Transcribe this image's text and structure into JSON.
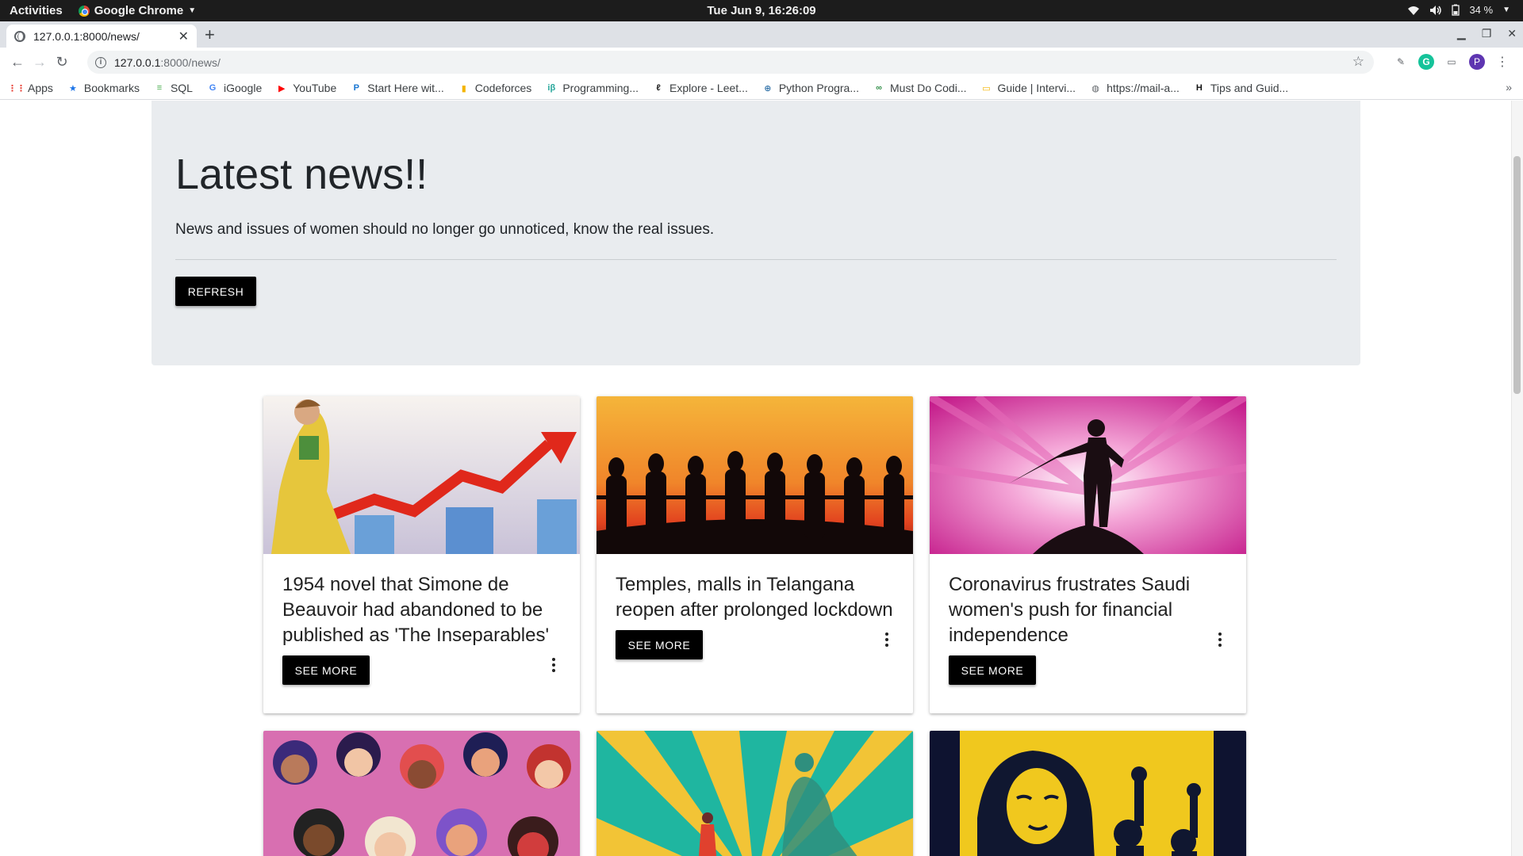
{
  "topbar": {
    "activities": "Activities",
    "app_name": "Google Chrome",
    "clock": "Tue Jun  9, 16:26:09",
    "battery": "34 %"
  },
  "browser": {
    "tab_title": "127.0.0.1:8000/news/",
    "url_host": "127.0.0.1",
    "url_path": ":8000/news/",
    "profile_initial": "P",
    "bookmarks": [
      {
        "label": "Apps",
        "icon": "apps-grid-icon",
        "color": "#e8453c"
      },
      {
        "label": "Bookmarks",
        "icon": "star-icon",
        "color": "#1a73e8"
      },
      {
        "label": "SQL",
        "icon": "sql-icon",
        "color": "#4caf50"
      },
      {
        "label": "iGoogle",
        "icon": "google-icon",
        "color": "#4285f4"
      },
      {
        "label": "YouTube",
        "icon": "youtube-icon",
        "color": "#ff0000"
      },
      {
        "label": "Start Here wit...",
        "icon": "p-circle-icon",
        "color": "#1976d2"
      },
      {
        "label": "Codeforces",
        "icon": "bars-icon",
        "color": "#f4b400"
      },
      {
        "label": "Programming...",
        "icon": "ib-icon",
        "color": "#26a69a"
      },
      {
        "label": "Explore - Leet...",
        "icon": "leetcode-icon",
        "color": "#222222"
      },
      {
        "label": "Python Progra...",
        "icon": "python-icon",
        "color": "#3776ab"
      },
      {
        "label": "Must Do Codi...",
        "icon": "gfg-icon",
        "color": "#2f8d46"
      },
      {
        "label": "Guide | Intervi...",
        "icon": "folder-icon",
        "color": "#f4b400"
      },
      {
        "label": "https://mail-a...",
        "icon": "globe-icon",
        "color": "#5f6368"
      },
      {
        "label": "Tips and Guid...",
        "icon": "h-box-icon",
        "color": "#111111"
      }
    ]
  },
  "jumbotron": {
    "title": "Latest news!!",
    "lead": "News and issues of women should no longer go unnoticed, know the real issues.",
    "refresh_label": "REFRESH"
  },
  "cards": [
    {
      "title": "1954 novel that Simone de Beauvoir had abandoned to be published as 'The Inseparables'",
      "button": "SEE MORE",
      "image": "woman-climbing-graph-illustration"
    },
    {
      "title": "Temples, malls in Telangana reopen after prolonged lockdown",
      "button": "SEE MORE",
      "image": "women-silhouettes-sunset"
    },
    {
      "title": "Coronavirus frustrates Saudi women's push for financial independence",
      "button": "SEE MORE",
      "image": "superhero-woman-silhouette-pink"
    },
    {
      "title": "",
      "button": "",
      "image": "diverse-women-faces-illustration"
    },
    {
      "title": "",
      "button": "",
      "image": "woman-shadow-superhero-teal"
    },
    {
      "title": "",
      "button": "",
      "image": "women-protest-yellow-poster"
    }
  ],
  "colors": {
    "jumbotron_bg": "#e9ecef",
    "button_bg": "#000000",
    "button_text": "#ffffff"
  }
}
